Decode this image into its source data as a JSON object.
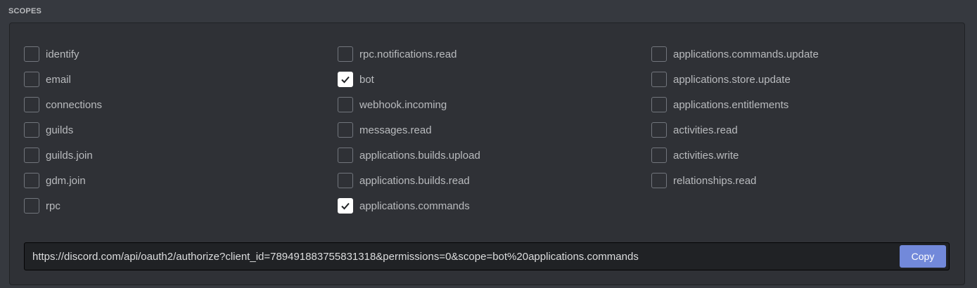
{
  "section": {
    "title": "SCOPES"
  },
  "columns": [
    [
      {
        "label": "identify",
        "checked": false
      },
      {
        "label": "email",
        "checked": false
      },
      {
        "label": "connections",
        "checked": false
      },
      {
        "label": "guilds",
        "checked": false
      },
      {
        "label": "guilds.join",
        "checked": false
      },
      {
        "label": "gdm.join",
        "checked": false
      },
      {
        "label": "rpc",
        "checked": false
      }
    ],
    [
      {
        "label": "rpc.notifications.read",
        "checked": false
      },
      {
        "label": "bot",
        "checked": true
      },
      {
        "label": "webhook.incoming",
        "checked": false
      },
      {
        "label": "messages.read",
        "checked": false
      },
      {
        "label": "applications.builds.upload",
        "checked": false
      },
      {
        "label": "applications.builds.read",
        "checked": false
      },
      {
        "label": "applications.commands",
        "checked": true
      }
    ],
    [
      {
        "label": "applications.commands.update",
        "checked": false
      },
      {
        "label": "applications.store.update",
        "checked": false
      },
      {
        "label": "applications.entitlements",
        "checked": false
      },
      {
        "label": "activities.read",
        "checked": false
      },
      {
        "label": "activities.write",
        "checked": false
      },
      {
        "label": "relationships.read",
        "checked": false
      }
    ]
  ],
  "url": {
    "value": "https://discord.com/api/oauth2/authorize?client_id=789491883755831318&permissions=0&scope=bot%20applications.commands",
    "copy_label": "Copy"
  },
  "colors": {
    "background": "#36393f",
    "panel": "#2f3136",
    "accent": "#7289da",
    "checked": "#ffffff"
  }
}
